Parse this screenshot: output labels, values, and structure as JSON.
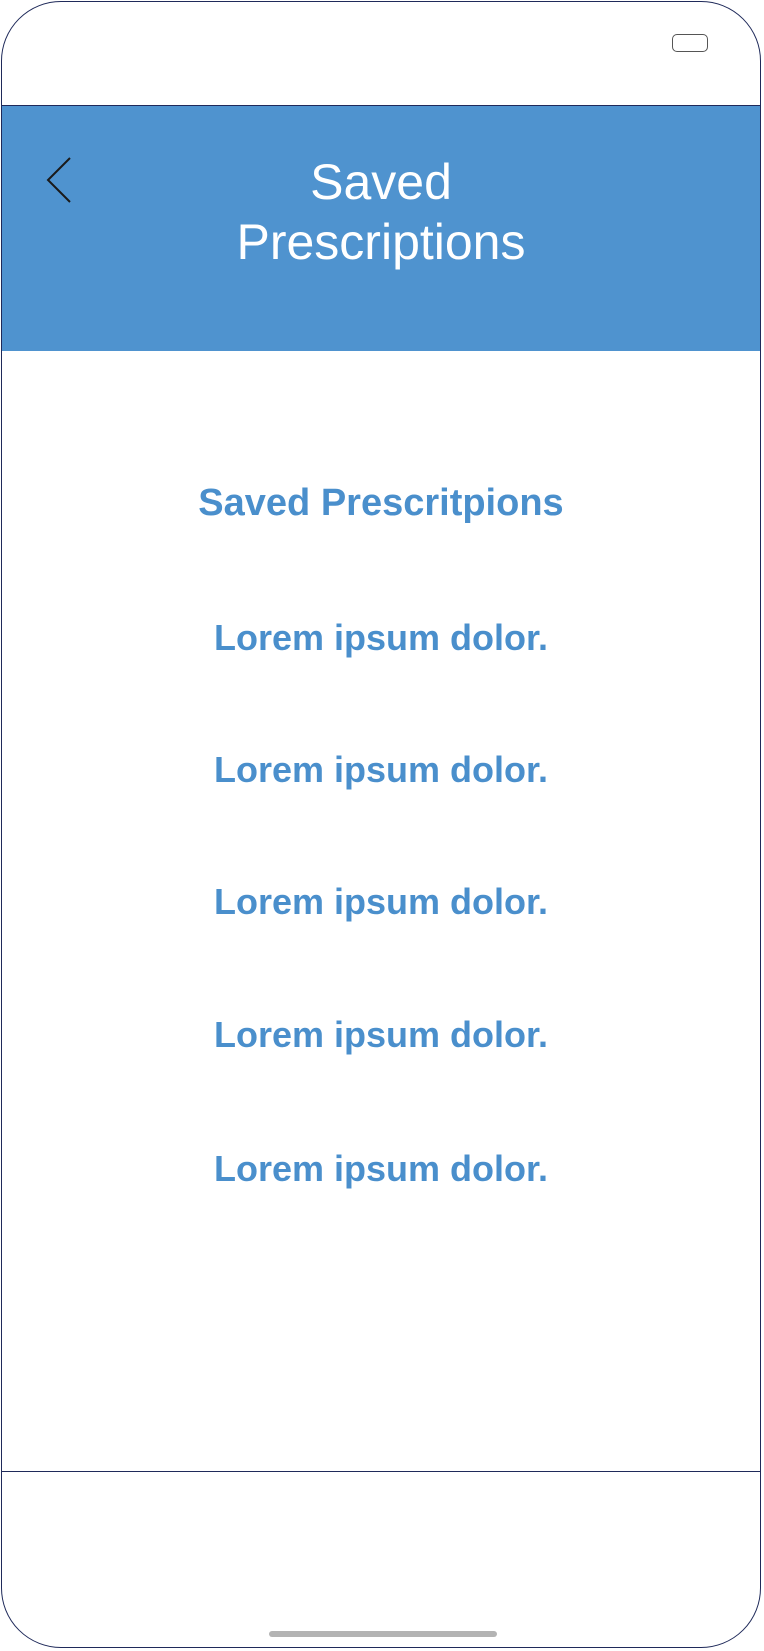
{
  "header": {
    "title_line1": "Saved",
    "title_line2": "Prescriptions"
  },
  "section": {
    "title": "Saved Prescritpions"
  },
  "items": [
    {
      "label": "Lorem ipsum dolor."
    },
    {
      "label": "Lorem ipsum dolor."
    },
    {
      "label": "Lorem ipsum dolor."
    },
    {
      "label": "Lorem ipsum dolor."
    },
    {
      "label": "Lorem ipsum dolor."
    }
  ],
  "icons": {
    "back": "chevron-left-icon",
    "battery": "battery-icon"
  },
  "colors": {
    "header_bg": "#4f93cf",
    "accent_text": "#4a8fcc",
    "frame": "#1f2a5a"
  }
}
